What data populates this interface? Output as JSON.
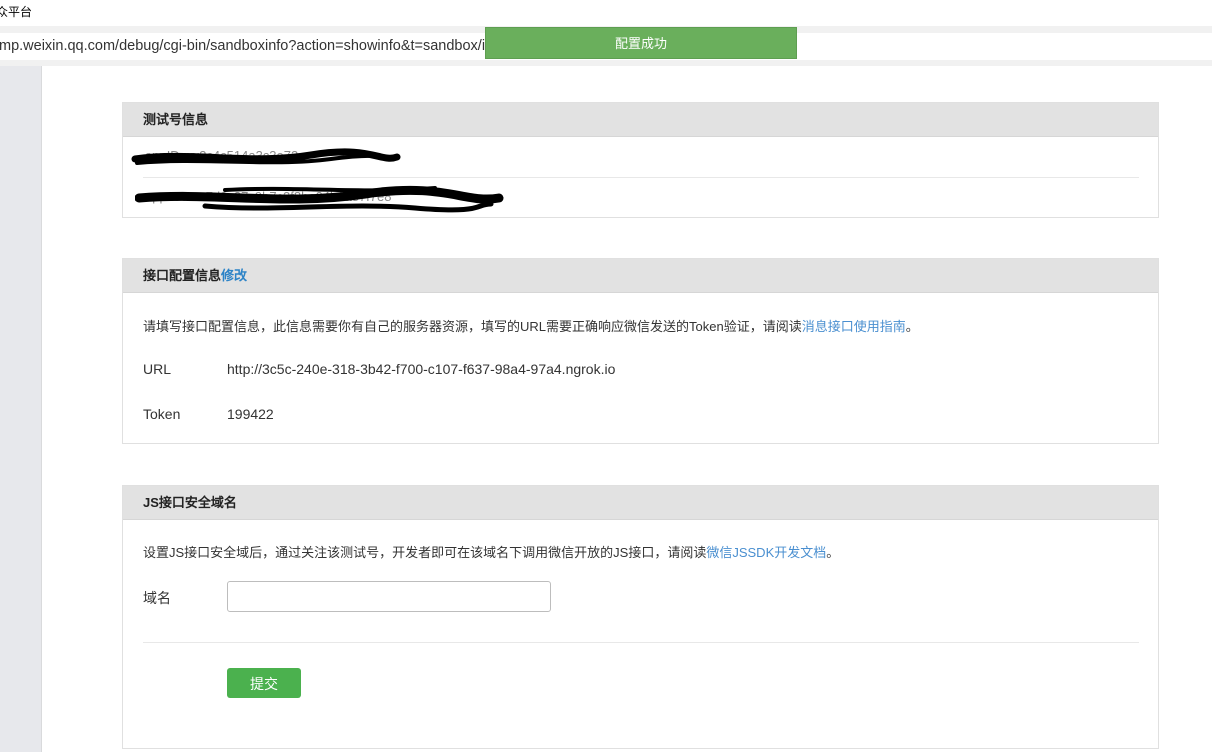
{
  "window": {
    "title": "众平台"
  },
  "address_bar": {
    "url": "mp.weixin.qq.com/debug/cgi-bin/sandboxinfo?action=showinfo&t=sandbox/index"
  },
  "toast": {
    "message": "配置成功"
  },
  "test_account_panel": {
    "title": "测试号信息",
    "rows": [
      {
        "faint_text": "appID  wx3c4c514a3c3e72"
      },
      {
        "faint_text": "appsecret  7d9c37c9b7c2f8be04b1a87f7e8"
      }
    ]
  },
  "interface_panel": {
    "title": "接口配置信息",
    "edit_link": "修改",
    "description": "请填写接口配置信息，此信息需要你有自己的服务器资源，填写的URL需要正确响应微信发送的Token验证，请阅读",
    "guide_link": "消息接口使用指南",
    "description_end": "。",
    "url_label": "URL",
    "url_value": "http://3c5c-240e-318-3b42-f700-c107-f637-98a4-97a4.ngrok.io",
    "token_label": "Token",
    "token_value": "199422"
  },
  "js_panel": {
    "title": "JS接口安全域名",
    "description": "设置JS接口安全域后，通过关注该测试号，开发者即可在该域名下调用微信开放的JS接口，请阅读",
    "doc_link": "微信JSSDK开发文档",
    "description_end": "。",
    "domain_label": "域名",
    "domain_value": "",
    "submit_label": "提交"
  },
  "colors": {
    "toast_bg": "#6aaf5c",
    "link": "#4a8fd0",
    "submit_bg": "#4bb14e",
    "panel_head_bg": "#e2e2e2"
  }
}
